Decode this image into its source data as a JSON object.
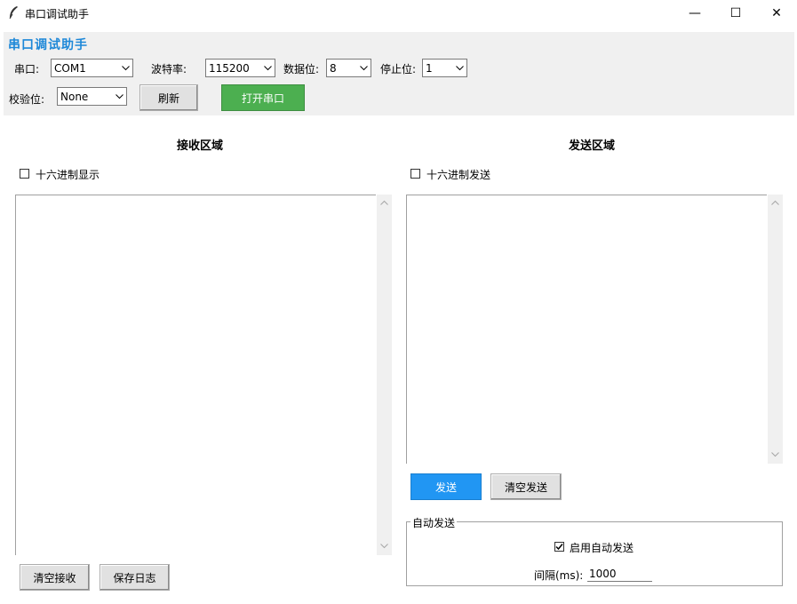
{
  "window": {
    "title": "串口调试助手",
    "controls": {
      "minimize": "—",
      "maximize": "☐",
      "close": "✕"
    }
  },
  "header": {
    "app_title": "串口调试助手"
  },
  "config": {
    "port_label": "串口:",
    "port_value": "COM1",
    "baud_label": "波特率:",
    "baud_value": "115200",
    "databits_label": "数据位:",
    "databits_value": "8",
    "stopbits_label": "停止位:",
    "stopbits_value": "1",
    "parity_label": "校验位:",
    "parity_value": "None",
    "refresh_label": "刷新",
    "open_label": "打开串口"
  },
  "receive": {
    "title": "接收区域",
    "hex_display_label": "十六进制显示",
    "hex_display_checked": false,
    "content": "",
    "clear_label": "清空接收",
    "save_label": "保存日志"
  },
  "send": {
    "title": "发送区域",
    "hex_send_label": "十六进制发送",
    "hex_send_checked": false,
    "content": "",
    "send_label": "发送",
    "clear_label": "清空发送"
  },
  "auto_send": {
    "group_label": "自动发送",
    "enable_label": "启用自动发送",
    "enable_checked": true,
    "interval_label": "间隔(ms):",
    "interval_value": "1000"
  },
  "colors": {
    "accent": "#1e88d8",
    "open_button": "#4caf50",
    "send_button": "#2196f3",
    "panel_bg": "#f0f0f0"
  }
}
